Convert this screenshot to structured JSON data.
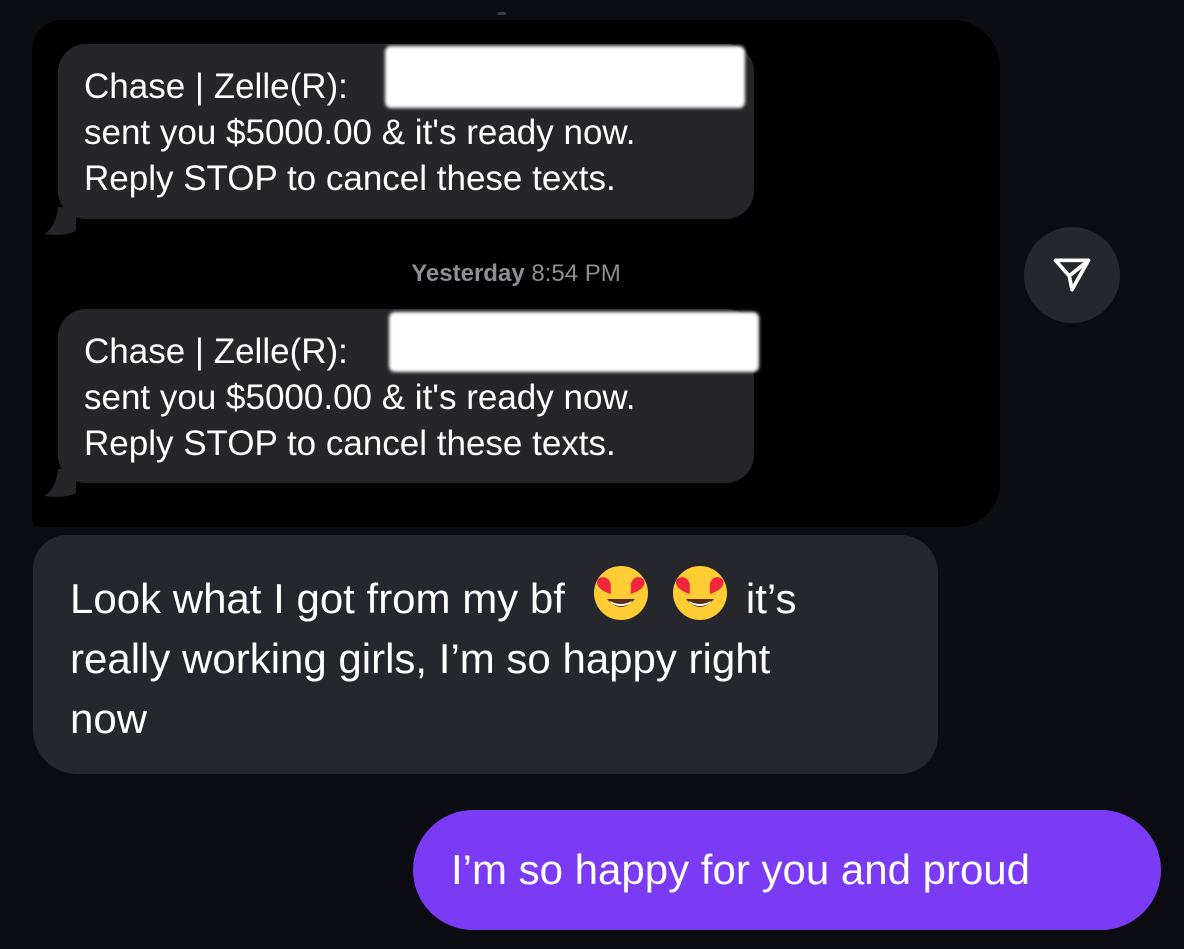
{
  "shared_screenshot": {
    "messages": [
      {
        "line1": "Chase | Zelle(R): ",
        "line2": "sent you $5000.00 & it's ready now.",
        "line3": "Reply STOP to cancel these texts."
      },
      {
        "line1": "Chase | Zelle(R): ",
        "line2": "sent you $5000.00 & it's ready now.",
        "line3": "Reply STOP to cancel these texts."
      }
    ],
    "timestamp_day": "Yesterday",
    "timestamp_time": "8:54 PM"
  },
  "share_button": {
    "icon": "paper-plane-icon"
  },
  "incoming": {
    "line1_before": "Look what I got from my bf",
    "line1_after": "it’s",
    "line2": "really working girls, I’m so happy right",
    "line3": "now",
    "emoji": "heart-eyes-emoji"
  },
  "outgoing": {
    "text": "I’m so happy for you and proud"
  },
  "colors": {
    "outgoing_bubble": "#7b3bf5",
    "incoming_bubble": "#25272d",
    "sms_bubble": "#26262a",
    "background": "#0c0d12"
  }
}
